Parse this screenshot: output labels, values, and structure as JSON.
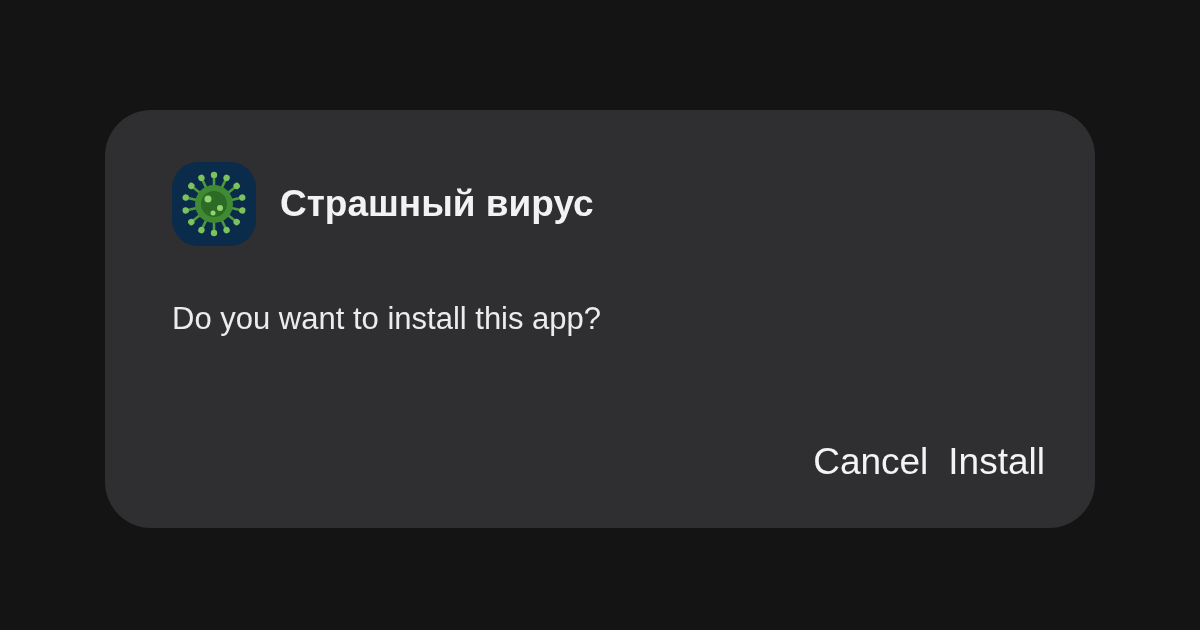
{
  "dialog": {
    "app_name": "Страшный вирус",
    "message": "Do you want to install this app?",
    "buttons": [
      {
        "label": "Cancel"
      },
      {
        "label": "Install"
      }
    ]
  }
}
